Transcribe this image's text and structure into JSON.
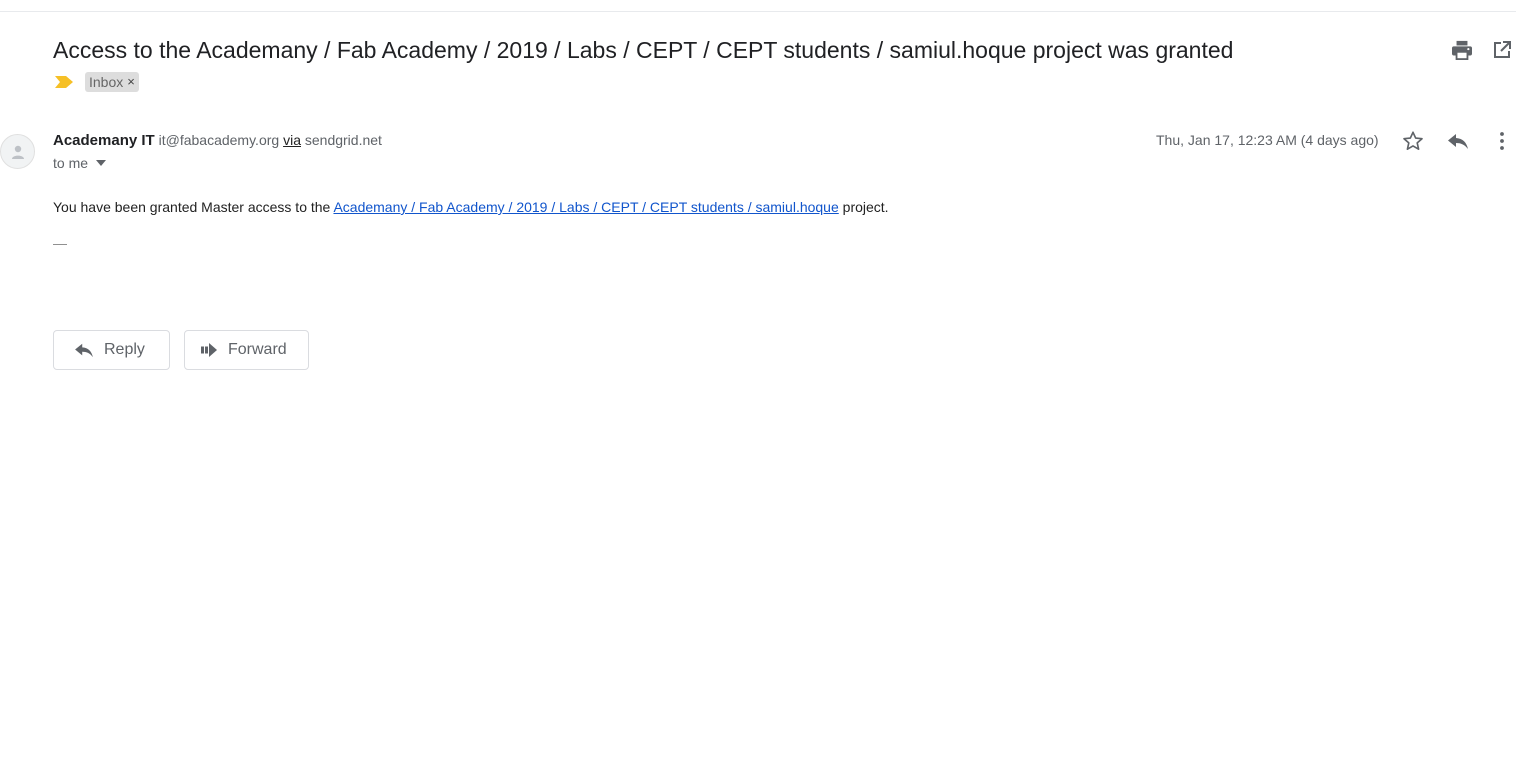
{
  "message": {
    "subject": "Access to the Academany / Fab Academy / 2019 / Labs / CEPT / CEPT students / samiul.hoque project was granted",
    "labels": [
      {
        "name": "Inbox",
        "remove_symbol": "×"
      }
    ],
    "sender": {
      "name": "Academany IT",
      "email": "it@fabacademy.org",
      "via_label": "via",
      "via_domain": "sendgrid.net"
    },
    "recipient_text": "to me",
    "date": "Thu, Jan 17, 12:23 AM (4 days ago)",
    "body": {
      "prefix": "You have been granted Master access to the ",
      "link_text": "Academany / Fab Academy / 2019 / Labs / CEPT / CEPT students / samiul.hoque",
      "suffix": " project."
    },
    "signature": "—"
  },
  "actions": {
    "reply_label": "Reply",
    "forward_label": "Forward"
  },
  "icons": {
    "print": "print-icon",
    "popout": "open-in-new-window-icon",
    "importance": "importance-marker-icon",
    "avatar": "person-icon",
    "star": "star-icon",
    "reply": "reply-icon",
    "more": "more-vertical-icon",
    "recipient_caret": "caret-down-icon",
    "forward": "forward-icon"
  },
  "colors": {
    "link": "#1155cc",
    "importance": "#f6c026",
    "label_bg": "#dddddd"
  }
}
